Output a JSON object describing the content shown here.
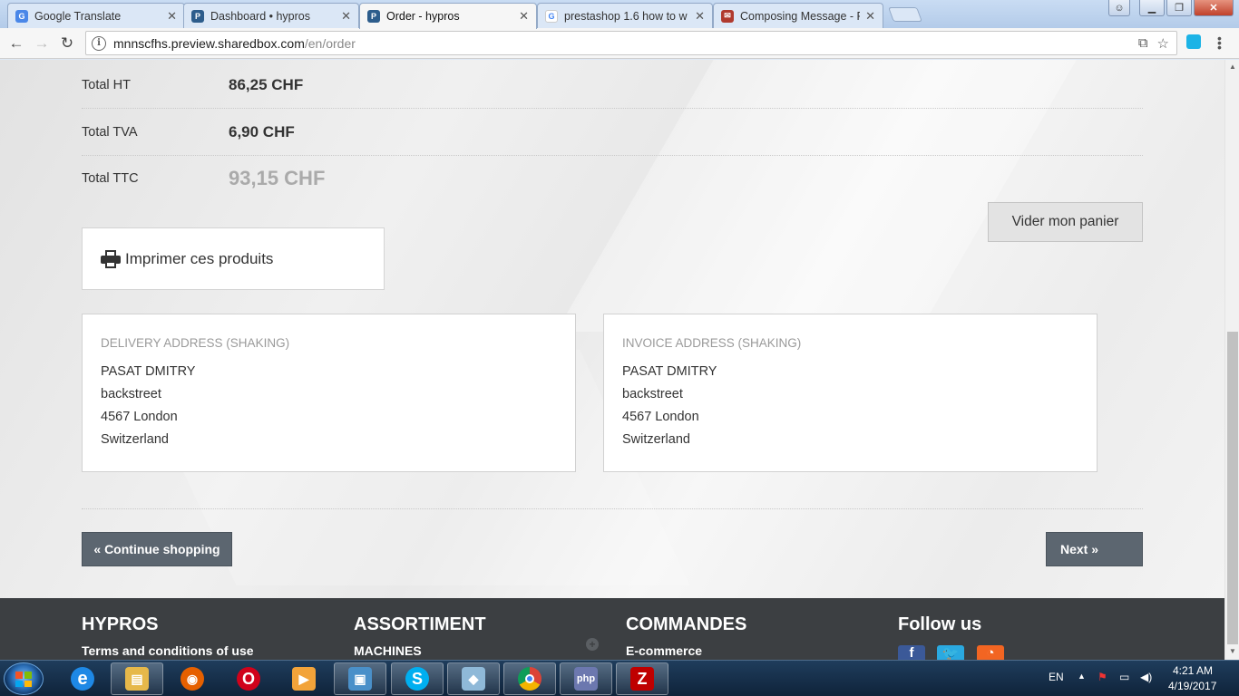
{
  "browser": {
    "tabs": [
      {
        "title": "Google Translate",
        "icon": "google-translate-icon",
        "color": "#4a87e8"
      },
      {
        "title": "Dashboard • hypros",
        "icon": "prestashop-icon",
        "color": "#2d5d8c"
      },
      {
        "title": "Order - hypros",
        "icon": "prestashop-icon",
        "color": "#2d5d8c"
      },
      {
        "title": "prestashop 1.6 how to w",
        "icon": "google-icon",
        "color": "#4285f4"
      },
      {
        "title": "Composing Message - Pr",
        "icon": "message-icon",
        "color": "#b03a2e"
      }
    ],
    "close_glyph": "✕",
    "url_host": "mnnscfhs.preview.sharedbox.com",
    "url_path": "/en/order"
  },
  "totals": [
    {
      "label": "Total HT",
      "value": "86,25 CHF"
    },
    {
      "label": "Total TVA",
      "value": "6,90 CHF"
    },
    {
      "label": "Total TTC",
      "value": "93,15 CHF"
    }
  ],
  "actions": {
    "clear_cart": "Vider mon panier",
    "print_products": "Imprimer ces produits",
    "continue_shopping": "« Continue shopping",
    "next": "Next »"
  },
  "delivery_address": {
    "title": "DELIVERY ADDRESS (SHAKING)",
    "lines": [
      "PASAT DMITRY",
      "backstreet",
      "4567 London",
      "Switzerland"
    ]
  },
  "invoice_address": {
    "title": "INVOICE ADDRESS (SHAKING)",
    "lines": [
      "PASAT DMITRY",
      "backstreet",
      "4567 London",
      "Switzerland"
    ]
  },
  "footer": {
    "columns": [
      {
        "heading": "HYPROS",
        "link": "Terms and conditions of use"
      },
      {
        "heading": "ASSORTIMENT",
        "link": "MACHINES"
      },
      {
        "heading": "COMMANDES",
        "link": "E-commerce"
      },
      {
        "heading": "Follow us",
        "link": ""
      }
    ],
    "social": [
      {
        "name": "facebook-icon",
        "glyph": "f",
        "color": "#3b5998"
      },
      {
        "name": "twitter-icon",
        "glyph": "t",
        "color": "#2aa9e0"
      },
      {
        "name": "rss-icon",
        "glyph": "◔",
        "color": "#f26522"
      }
    ]
  },
  "taskbar": {
    "apps": [
      {
        "name": "internet-explorer-icon",
        "color": "#1e88e5",
        "glyph": "e",
        "open": false
      },
      {
        "name": "file-explorer-icon",
        "color": "#e6b84a",
        "glyph": "▤",
        "open": true
      },
      {
        "name": "firefox-icon",
        "color": "#e66000",
        "glyph": "◉",
        "open": false
      },
      {
        "name": "opera-icon",
        "color": "#d0021b",
        "glyph": "O",
        "open": false
      },
      {
        "name": "media-player-icon",
        "color": "#f2a33a",
        "glyph": "▶",
        "open": false
      },
      {
        "name": "photo-viewer-icon",
        "color": "#4a90c9",
        "glyph": "▣",
        "open": true
      },
      {
        "name": "skype-icon",
        "color": "#00aff0",
        "glyph": "S",
        "open": true
      },
      {
        "name": "notes-icon",
        "color": "#8fb9d8",
        "glyph": "◆",
        "open": true
      },
      {
        "name": "chrome-icon",
        "color": "#4caf50",
        "glyph": "◎",
        "open": true
      },
      {
        "name": "php-icon",
        "color": "#6c78af",
        "glyph": "php",
        "open": true
      },
      {
        "name": "filezilla-icon",
        "color": "#bf0000",
        "glyph": "Z",
        "open": true
      }
    ],
    "language": "EN",
    "time": "4:21 AM",
    "date": "4/19/2017"
  }
}
